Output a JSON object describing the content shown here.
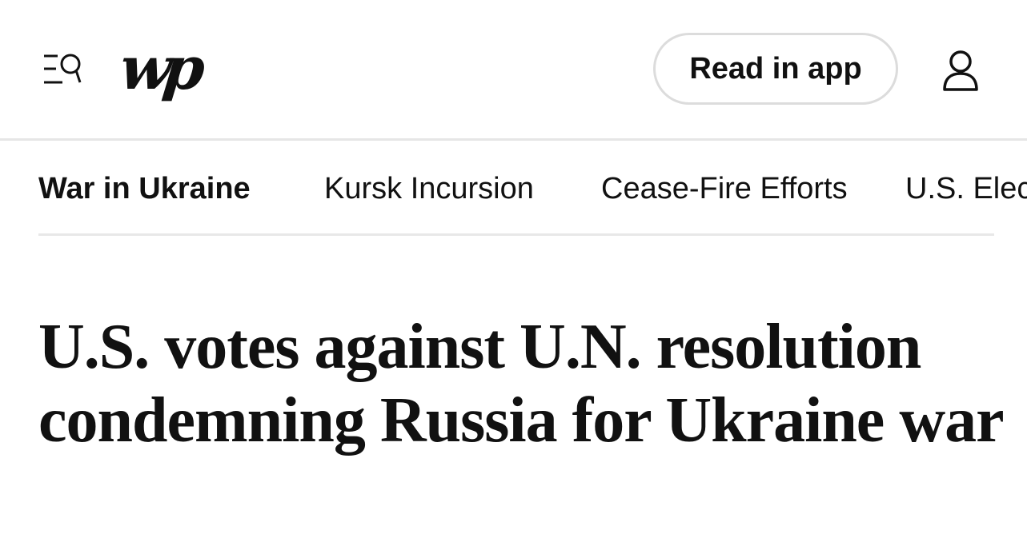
{
  "header": {
    "menu_icon": "menu-search-icon",
    "logo_text": "wp",
    "read_in_app_label": "Read in app",
    "account_icon": "user-icon"
  },
  "nav": {
    "items": [
      {
        "label": "War in Ukraine",
        "active": true
      },
      {
        "label": "Kursk Incursion",
        "active": false
      },
      {
        "label": "Cease-Fire Efforts",
        "active": false
      },
      {
        "label": "U.S. Elec",
        "active": false
      }
    ]
  },
  "article": {
    "headline": "U.S. votes against U.N. resolution condemning Russia for Ukraine war"
  }
}
